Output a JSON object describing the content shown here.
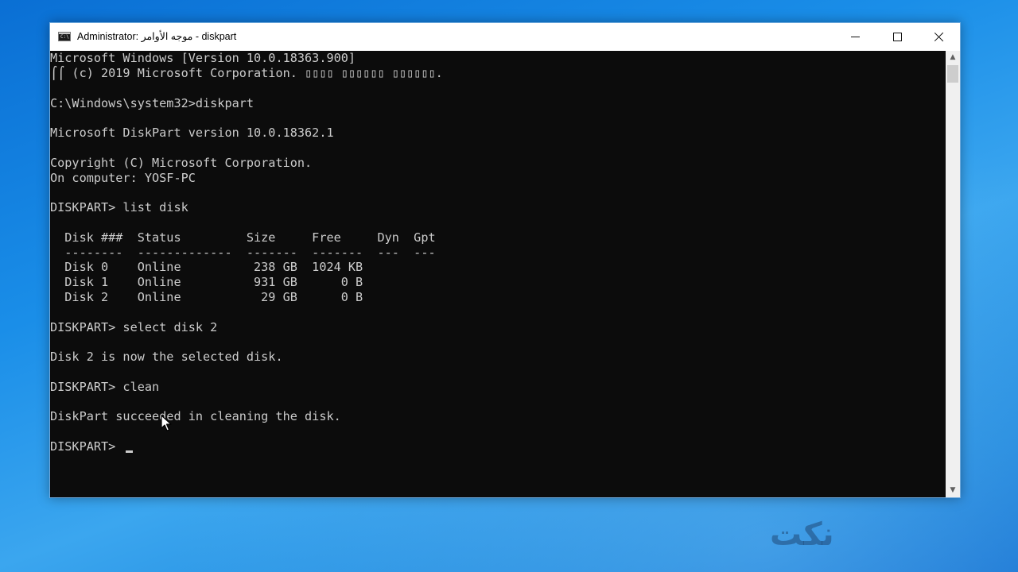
{
  "window": {
    "title": "Administrator: موجه الأوامر - diskpart",
    "icon": "cmd-icon",
    "buttons": {
      "minimize": "minimize-icon",
      "maximize": "maximize-icon",
      "close": "close-icon"
    }
  },
  "console": {
    "lines": [
      "Microsoft Windows [Version 10.0.18363.900]",
      "⌠⌠ (c) 2019 Microsoft Corporation. ▯▯▯▯ ▯▯▯▯▯▯ ▯▯▯▯▯▯.",
      "",
      "C:\\Windows\\system32>diskpart",
      "",
      "Microsoft DiskPart version 10.0.18362.1",
      "",
      "Copyright (C) Microsoft Corporation.",
      "On computer: YOSF-PC",
      "",
      "DISKPART> list disk",
      "",
      "  Disk ###  Status         Size     Free     Dyn  Gpt",
      "  --------  -------------  -------  -------  ---  ---",
      "  Disk 0    Online          238 GB  1024 KB",
      "  Disk 1    Online          931 GB      0 B",
      "  Disk 2    Online           29 GB      0 B",
      "",
      "DISKPART> select disk 2",
      "",
      "Disk 2 is now the selected disk.",
      "",
      "DISKPART> clean",
      "",
      "DiskPart succeeded in cleaning the disk.",
      "",
      "DISKPART> "
    ]
  },
  "scrollbar": {
    "up_arrow": "▲",
    "down_arrow": "▼"
  },
  "watermark": {
    "text": "نكت"
  },
  "colors": {
    "console_bg": "#0c0c0c",
    "console_fg": "#cccccc",
    "titlebar_bg": "#ffffff",
    "desktop": "#1a8ee8"
  }
}
